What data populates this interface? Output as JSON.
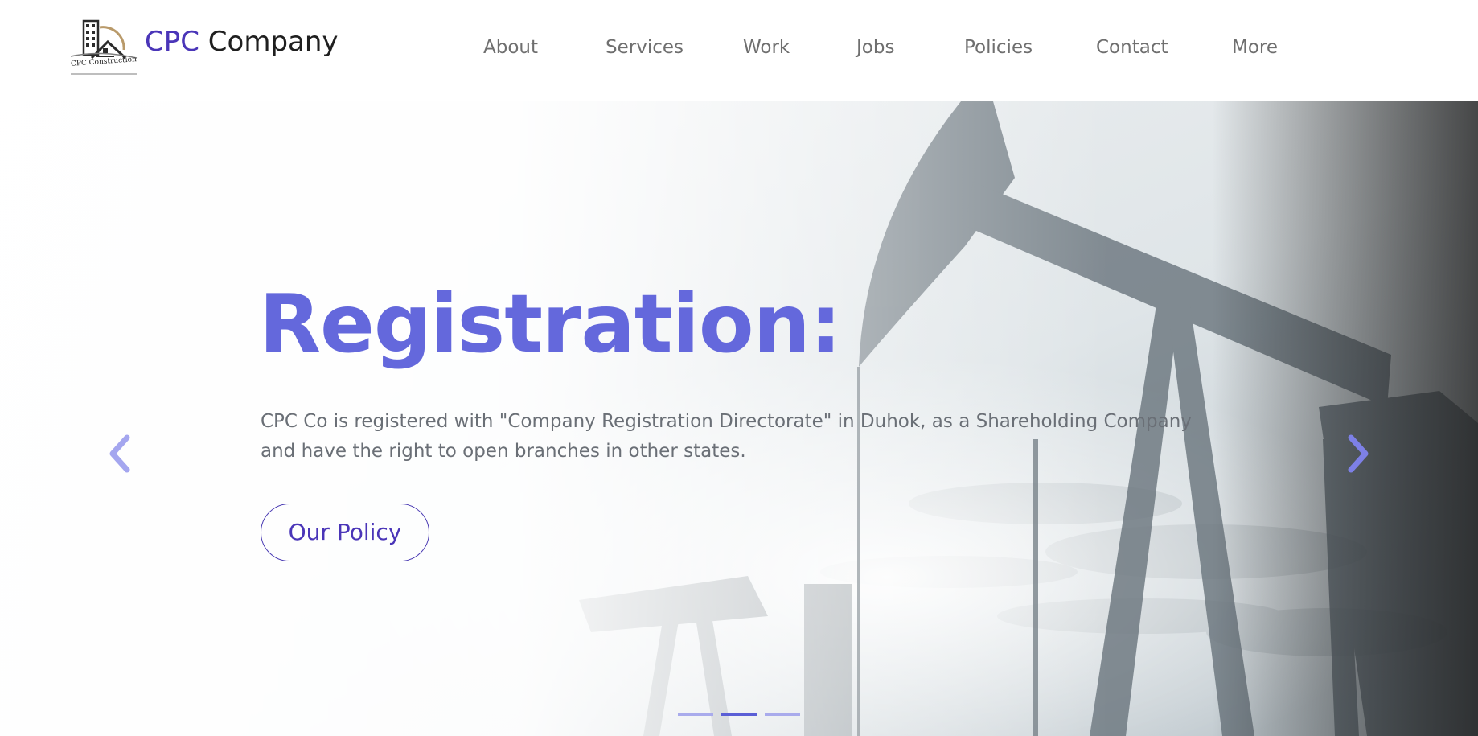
{
  "header": {
    "brand_primary": "CPC",
    "brand_secondary": "Company",
    "logo_text": "CPC Construction",
    "nav": [
      {
        "label": "About"
      },
      {
        "label": "Services"
      },
      {
        "label": "Work"
      },
      {
        "label": "Jobs"
      },
      {
        "label": "Policies"
      },
      {
        "label": "Contact"
      },
      {
        "label": "More"
      }
    ]
  },
  "hero": {
    "title": "Registration:",
    "text": "CPC Co is registered with \"Company Registration Directorate\" in Duhok, as a Shareholding Company and have the right to open branches in other states.",
    "button_label": "Our Policy",
    "prev_icon": "chevron-left-icon",
    "next_icon": "chevron-right-icon",
    "slides_total": 3,
    "active_slide": 2
  },
  "colors": {
    "brand": "#4a35b8",
    "title": "#6468dc",
    "nav_text": "#6f6f6f",
    "body_text": "#6a6f76",
    "indicator_active": "#5b5fd6",
    "indicator_inactive": "#a9abec"
  }
}
